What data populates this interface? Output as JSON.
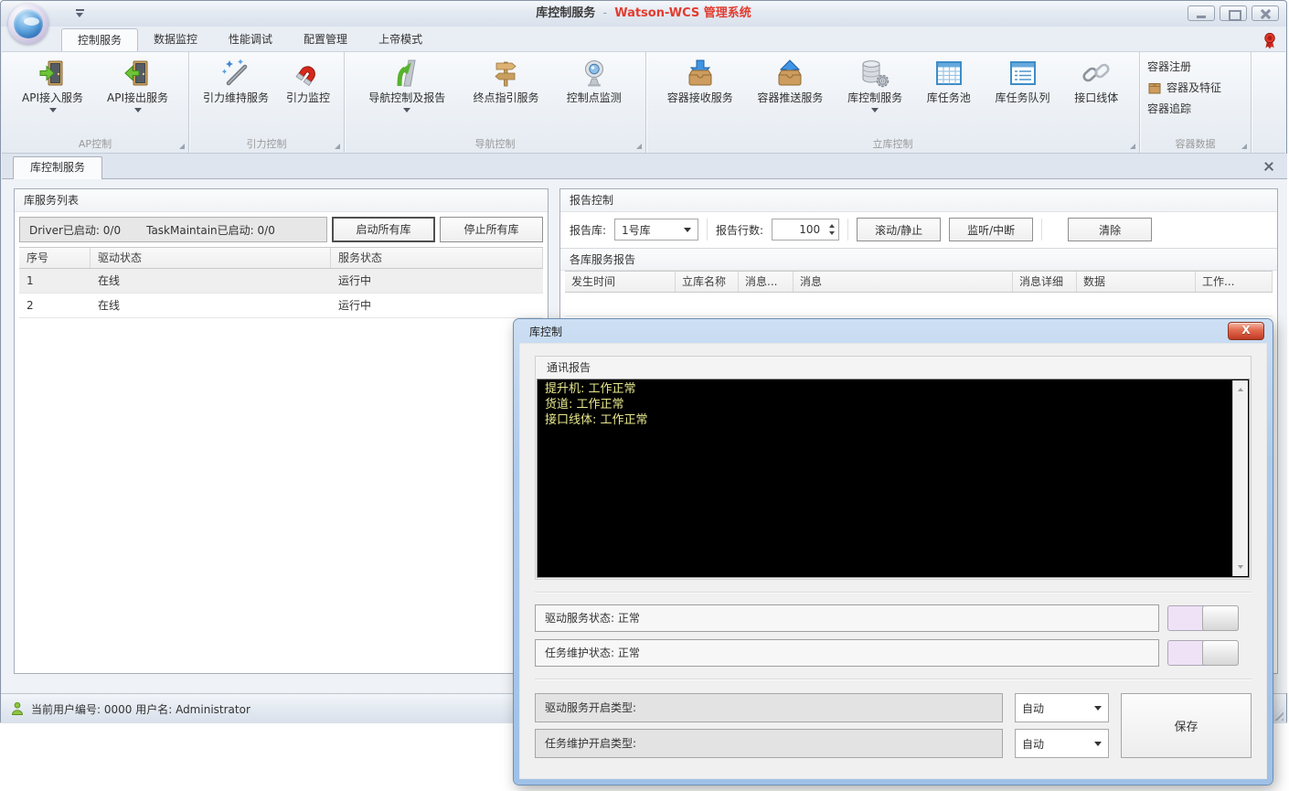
{
  "titlebar": {
    "title_primary": "库控制服务",
    "title_dash": "-",
    "title_secondary": "Watson-WCS 管理系统"
  },
  "ribbon": {
    "tabs": [
      "控制服务",
      "数据监控",
      "性能调试",
      "配置管理",
      "上帝模式"
    ],
    "groups": [
      "AP控制",
      "引力控制",
      "导航控制",
      "立库控制",
      "容器数据"
    ],
    "buttons": {
      "api_in": "API接入服务",
      "api_out": "API接出服务",
      "gravity_keep": "引力维持服务",
      "gravity_watch": "引力监控",
      "nav_report": "导航控制及报告",
      "endpoint_guide": "终点指引服务",
      "point_monitor": "控制点监测",
      "container_recv": "容器接收服务",
      "container_push": "容器推送服务",
      "lib_control": "库控制服务",
      "task_pool": "库任务池",
      "task_queue": "库任务队列",
      "interface_line": "接口线体",
      "container_reg": "容器注册",
      "container_feat": "容器及特征",
      "container_track": "容器追踪"
    }
  },
  "doc_tab": {
    "label": "库控制服务"
  },
  "service_panel": {
    "title": "库服务列表",
    "driver_info": "Driver已启动: 0/0",
    "task_info": "TaskMaintain已启动: 0/0",
    "start_all": "启动所有库",
    "stop_all": "停止所有库",
    "headers": [
      "序号",
      "驱动状态",
      "服务状态"
    ],
    "rows": [
      {
        "no": "1",
        "drive": "在线",
        "service": "运行中"
      },
      {
        "no": "2",
        "drive": "在线",
        "service": "运行中"
      }
    ]
  },
  "report_panel": {
    "title": "报告控制",
    "lib_label": "报告库:",
    "lib_value": "1号库",
    "lines_label": "报告行数:",
    "lines_value": "100",
    "btn_scroll": "滚动/静止",
    "btn_listen": "监听/中断",
    "btn_clear": "清除",
    "table_title": "各库服务报告",
    "table_headers": [
      "发生时间",
      "立库名称",
      "消息...",
      "消息",
      "消息详细",
      "数据",
      "工作..."
    ]
  },
  "dialog": {
    "title": "库控制",
    "close_label": "X",
    "console_title": "通讯报告",
    "console_lines": [
      "提升机: 工作正常",
      "货道: 工作正常",
      "接口线体: 工作正常"
    ],
    "status_drive": "驱动服务状态: 正常",
    "status_task": "任务维护状态: 正常",
    "type_drive_label": "驱动服务开启类型:",
    "type_drive_value": "自动",
    "type_task_label": "任务维护开启类型:",
    "type_task_value": "自动",
    "save_label": "保存"
  },
  "statusbar": {
    "user_info": "当前用户编号: 0000 用户名: Administrator"
  },
  "colors": {
    "title_accent": "#E23B2E",
    "console_text": "#E9E98F",
    "dialog_chrome": "#A9C6EA",
    "toggle_track": "#EFE2F7"
  }
}
